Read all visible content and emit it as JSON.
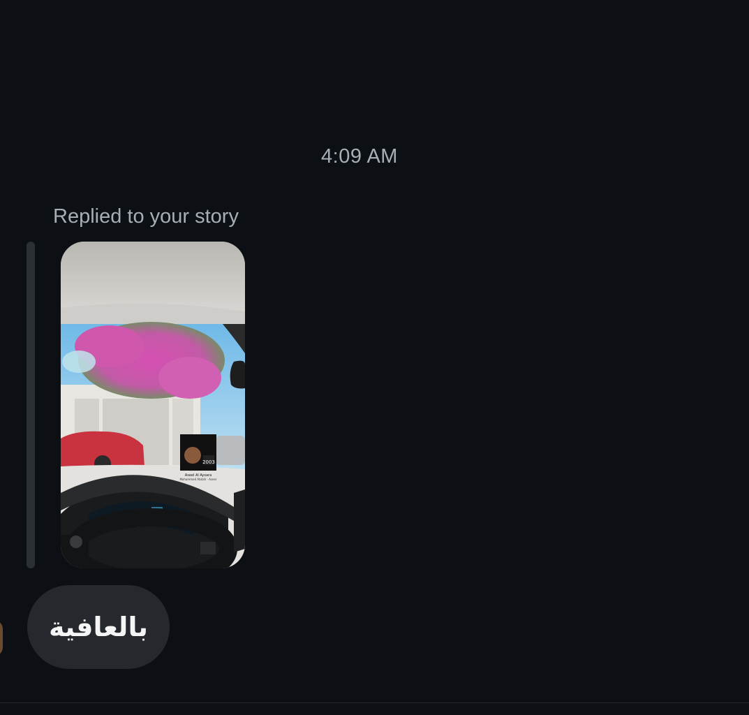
{
  "thread": {
    "timestamp": "4:09 AM",
    "reply_context": "Replied to your story",
    "story_thumbnail": {
      "album_artist": "Aseel Al Aysara",
      "album_year": "2003",
      "album_subtitle": "Mohammed Abdah - Aseer"
    },
    "message": {
      "text": "بالعافية"
    }
  },
  "colors": {
    "background": "#0c1014",
    "bubble": "#25292e",
    "muted_text": "#a8aeb6",
    "message_text": "#f5f5f5"
  }
}
